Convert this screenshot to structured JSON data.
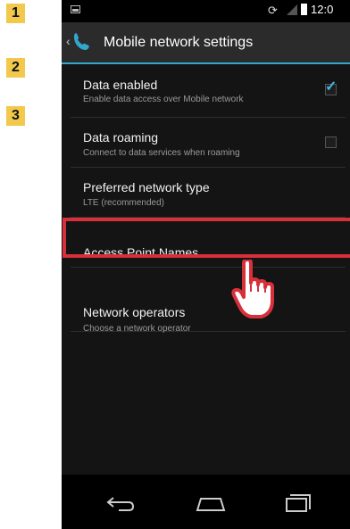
{
  "steps": [
    "1",
    "2",
    "3"
  ],
  "status_bar": {
    "time": "12:0"
  },
  "action_bar": {
    "title": "Mobile network settings"
  },
  "settings": [
    {
      "label": "Data enabled",
      "sub": "Enable data access over Mobile network",
      "checkbox": true,
      "checked": true
    },
    {
      "label": "Data roaming",
      "sub": "Connect to data services when roaming",
      "checkbox": true,
      "checked": false
    },
    {
      "label": "Preferred network type",
      "sub": "LTE (recommended)"
    },
    {
      "label": "Access Point Names",
      "sub": ""
    },
    {
      "label": "Network operators",
      "sub": "Choose a network operator"
    }
  ],
  "colors": {
    "accent": "#33a6cc",
    "highlight": "#d8303a",
    "badge": "#f2c94c"
  },
  "icons": [
    "image-icon",
    "screen-rotation-icon",
    "signal-icon",
    "battery-icon",
    "phone-icon",
    "back-icon",
    "home-icon",
    "recent-apps-icon",
    "pointing-hand-icon"
  ]
}
